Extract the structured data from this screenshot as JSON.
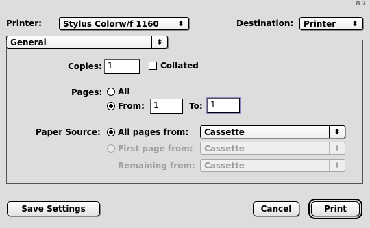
{
  "version": "8.7",
  "printer": {
    "label": "Printer:",
    "value": "Stylus Colorw/f 1160"
  },
  "destination": {
    "label": "Destination:",
    "value": "Printer"
  },
  "panel": {
    "value": "General"
  },
  "copies": {
    "label": "Copies:",
    "value": "1",
    "collated_label": "Collated",
    "collated": false
  },
  "pages": {
    "label": "Pages:",
    "all_label": "All",
    "from_label": "From:",
    "from_value": "1",
    "to_label": "To:",
    "to_value": "1",
    "selected": "from"
  },
  "paper_source": {
    "label": "Paper Source:",
    "all_pages_label": "All pages from:",
    "all_pages_value": "Cassette",
    "first_page_label": "First page from:",
    "first_page_value": "Cassette",
    "remaining_label": "Remaining from:",
    "remaining_value": "Cassette",
    "selected": "all_pages"
  },
  "buttons": {
    "save_settings": "Save Settings",
    "cancel": "Cancel",
    "print": "Print"
  },
  "icons": {
    "popup_arrows": "up-down-arrows-icon"
  }
}
